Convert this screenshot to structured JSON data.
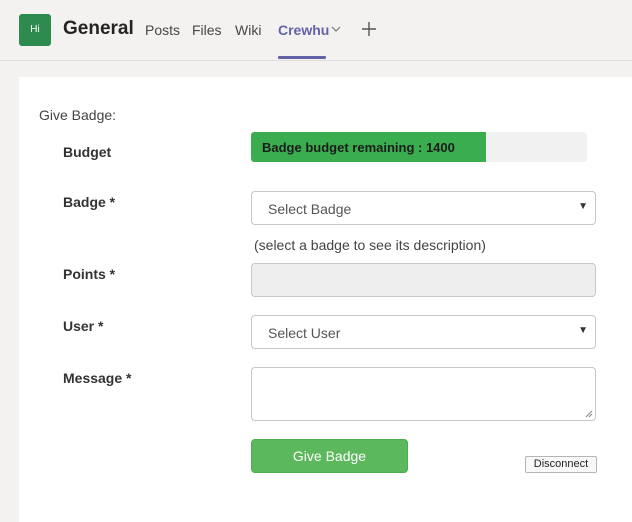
{
  "header": {
    "avatar_text": "Hi",
    "avatar_color": "#2e8b4f",
    "channel": "General",
    "tabs": [
      {
        "label": "Posts"
      },
      {
        "label": "Files"
      },
      {
        "label": "Wiki"
      },
      {
        "label": "Crewhu"
      }
    ],
    "active_tab_color": "#6264a7",
    "add_tab_icon": "plus-icon",
    "tab_menu_icon": "chevron-down-icon"
  },
  "form": {
    "title": "Give Badge:",
    "budget": {
      "label": "Budget",
      "text": "Badge budget remaining : 1400",
      "fill_fraction": 0.7,
      "fill_color": "#3aae4f"
    },
    "badge": {
      "label": "Badge *",
      "selected": "Select Badge",
      "hint": "(select a badge to see its description)"
    },
    "points": {
      "label": "Points *",
      "value": ""
    },
    "user": {
      "label": "User *",
      "selected": "Select User"
    },
    "message": {
      "label": "Message *",
      "value": ""
    },
    "submit_label": "Give Badge",
    "submit_color": "#5cb85c",
    "disconnect_label": "Disconnect"
  }
}
